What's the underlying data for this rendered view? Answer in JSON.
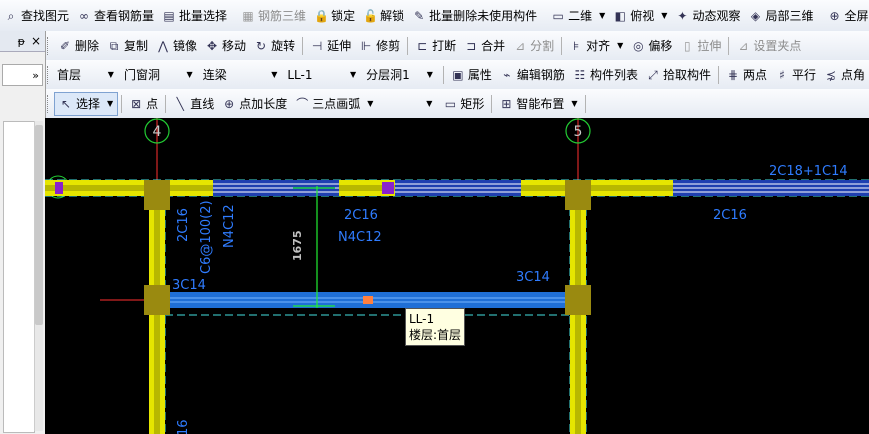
{
  "toolbar1": [
    {
      "label": "查找图元",
      "icon": "find-icon",
      "glyph": "⌕",
      "enabled": true
    },
    {
      "label": "查看钢筋量",
      "icon": "rebar-quantity-icon",
      "glyph": "∞",
      "enabled": true
    },
    {
      "label": "批量选择",
      "icon": "batch-select-icon",
      "glyph": "▤",
      "enabled": true
    },
    {
      "label": "钢筋三维",
      "icon": "rebar-3d-icon",
      "glyph": "▦",
      "enabled": false
    },
    {
      "label": "锁定",
      "icon": "lock-icon",
      "glyph": "🔒",
      "enabled": true
    },
    {
      "label": "解锁",
      "icon": "unlock-icon",
      "glyph": "🔓",
      "enabled": true
    },
    {
      "label": "批量删除未使用构件",
      "icon": "batch-delete-icon",
      "glyph": "✎",
      "enabled": true
    },
    {
      "label": "二维",
      "icon": "2d-view-icon",
      "glyph": "▭",
      "enabled": true,
      "dropdown": true
    },
    {
      "label": "俯视",
      "icon": "top-view-icon",
      "glyph": "◧",
      "enabled": true,
      "dropdown": true
    },
    {
      "label": "动态观察",
      "icon": "orbit-icon",
      "glyph": "✦",
      "enabled": true
    },
    {
      "label": "局部三维",
      "icon": "local-3d-icon",
      "glyph": "◈",
      "enabled": true
    },
    {
      "label": "全屏",
      "icon": "fullscreen-icon",
      "glyph": "⊕",
      "enabled": true
    }
  ],
  "toolbar2": [
    {
      "label": "删除",
      "icon": "delete-icon",
      "glyph": "✐",
      "enabled": true
    },
    {
      "label": "复制",
      "icon": "copy-icon",
      "glyph": "⧉",
      "enabled": true
    },
    {
      "label": "镜像",
      "icon": "mirror-icon",
      "glyph": "⋀",
      "enabled": true
    },
    {
      "label": "移动",
      "icon": "move-icon",
      "glyph": "✥",
      "enabled": true
    },
    {
      "label": "旋转",
      "icon": "rotate-icon",
      "glyph": "↻",
      "enabled": true
    },
    {
      "label": "延伸",
      "icon": "extend-icon",
      "glyph": "⊣",
      "enabled": true
    },
    {
      "label": "修剪",
      "icon": "trim-icon",
      "glyph": "⊩",
      "enabled": true
    },
    {
      "label": "打断",
      "icon": "break-icon",
      "glyph": "⊏",
      "enabled": true
    },
    {
      "label": "合并",
      "icon": "merge-icon",
      "glyph": "⊐",
      "enabled": true
    },
    {
      "label": "分割",
      "icon": "split-icon",
      "glyph": "⊿",
      "enabled": false
    },
    {
      "label": "对齐",
      "icon": "align-icon",
      "glyph": "⊧",
      "enabled": true,
      "dropdown": true
    },
    {
      "label": "偏移",
      "icon": "offset-icon",
      "glyph": "◎",
      "enabled": true
    },
    {
      "label": "拉伸",
      "icon": "stretch-icon",
      "glyph": "▯",
      "enabled": false
    },
    {
      "label": "设置夹点",
      "icon": "grip-point-icon",
      "glyph": "⊿",
      "enabled": false
    }
  ],
  "toolbar3": {
    "selectors": [
      {
        "name": "floor-select",
        "value": "首层",
        "width": 58
      },
      {
        "name": "component-type-select",
        "value": "门窗洞",
        "width": 70
      },
      {
        "name": "component-category-select",
        "value": "连梁",
        "width": 76
      },
      {
        "name": "component-name-select",
        "value": "LL-1",
        "width": 70
      },
      {
        "name": "sublayer-select",
        "value": "分层洞1",
        "width": 68
      }
    ],
    "buttons": [
      {
        "label": "属性",
        "icon": "properties-icon",
        "glyph": "▣"
      },
      {
        "label": "编辑钢筋",
        "icon": "edit-rebar-icon",
        "glyph": "⌁"
      },
      {
        "label": "构件列表",
        "icon": "component-list-icon",
        "glyph": "☷"
      },
      {
        "label": "拾取构件",
        "icon": "pick-component-icon",
        "glyph": "⤢"
      },
      {
        "label": "两点",
        "icon": "two-point-icon",
        "glyph": "⋕"
      },
      {
        "label": "平行",
        "icon": "parallel-icon",
        "glyph": "♯"
      },
      {
        "label": "点角",
        "icon": "point-angle-icon",
        "glyph": "⋨"
      }
    ]
  },
  "toolbar4": {
    "buttons": [
      {
        "label": "选择",
        "icon": "select-cursor-icon",
        "glyph": "↖",
        "dropdown": true,
        "active": true
      },
      {
        "label": "点",
        "icon": "point-icon",
        "glyph": "⊠"
      },
      {
        "label": "直线",
        "icon": "line-icon",
        "glyph": "╲"
      },
      {
        "label": "点加长度",
        "icon": "point-length-icon",
        "glyph": "⊕"
      },
      {
        "label": "三点画弧",
        "icon": "arc-icon",
        "glyph": "⌒",
        "dropdown": true
      }
    ],
    "empty_select_value": "",
    "buttons2": [
      {
        "label": "矩形",
        "icon": "rectangle-icon",
        "glyph": "▭"
      },
      {
        "label": "智能布置",
        "icon": "smart-layout-icon",
        "glyph": "⊞",
        "dropdown": true
      }
    ]
  },
  "left_panel": {
    "pin_label": "ᵽ",
    "close_label": "×",
    "expand_label": "»"
  },
  "canvas": {
    "axis_labels": [
      "4",
      "5"
    ],
    "dimension": "1675",
    "annotations": {
      "top_right": "2C18+1C14",
      "top_mid": "2C16",
      "top_right_mid": "2C16",
      "mid": "N4C12",
      "vertical_1": "2C16",
      "vertical_2": "C6@100(2)",
      "vertical_3": "N4C12",
      "beam_left": "3C14",
      "beam_right": "3C14",
      "bottom_fragment": "16"
    },
    "tooltip": {
      "name": "LL-1",
      "floor": "楼层:首层"
    },
    "colors": {
      "background": "#000000",
      "beam_yellow": "#e6e600",
      "beam_blue": "#1f6fd6",
      "text_blue": "#2f7cff",
      "axis_green": "#22cc33",
      "column": "#9a8a10"
    }
  }
}
